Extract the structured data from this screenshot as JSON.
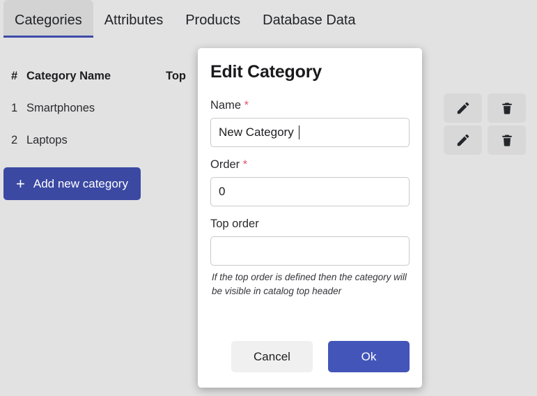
{
  "tabs": [
    {
      "label": "Categories",
      "active": true
    },
    {
      "label": "Attributes",
      "active": false
    },
    {
      "label": "Products",
      "active": false
    },
    {
      "label": "Database Data",
      "active": false
    }
  ],
  "table": {
    "headers": {
      "num": "#",
      "name": "Category Name",
      "top": "Top"
    },
    "rows": [
      {
        "num": "1",
        "name": "Smartphones",
        "link": ""
      },
      {
        "num": "2",
        "name": "Laptops",
        "link": ")"
      }
    ],
    "edit_icon": "pencil-icon",
    "delete_icon": "trash-icon"
  },
  "add_button": {
    "label": "Add new category",
    "icon": "plus-icon"
  },
  "modal": {
    "title": "Edit Category",
    "name": {
      "label": "Name",
      "required": "*",
      "value": "New Category",
      "placeholder": ""
    },
    "order": {
      "label": "Order",
      "required": "*",
      "value": "0",
      "placeholder": ""
    },
    "top_order": {
      "label": "Top order",
      "value": "",
      "placeholder": "",
      "hint": "If the top order is defined then the category will be visible in catalog top header"
    },
    "cancel_label": "Cancel",
    "ok_label": "Ok"
  },
  "colors": {
    "accent": "#3b49a3",
    "ok_button": "#4355b8",
    "page_bg": "#e2e2e2",
    "active_tab_bg": "#d3d3d3",
    "required_red": "#e0566f",
    "link_blue": "#2b6cb8"
  }
}
